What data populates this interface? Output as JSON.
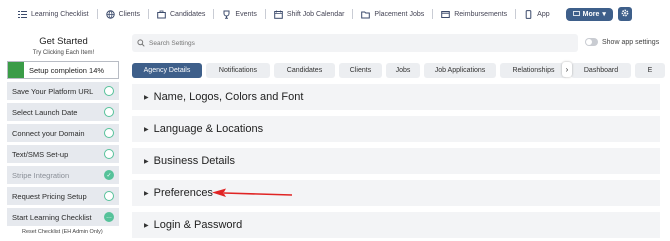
{
  "nav": {
    "items": [
      {
        "label": "Learning Checklist",
        "icon": "list-icon"
      },
      {
        "label": "Clients",
        "icon": "globe-icon"
      },
      {
        "label": "Candidates",
        "icon": "briefcase-icon"
      },
      {
        "label": "Events",
        "icon": "trophy-icon"
      },
      {
        "label": "Shift Job Calendar",
        "icon": "calendar-icon"
      },
      {
        "label": "Placement Jobs",
        "icon": "folder-icon"
      },
      {
        "label": "Reimbursements",
        "icon": "receipt-icon"
      },
      {
        "label": "App",
        "icon": "mobile-icon"
      }
    ],
    "more_label": "More",
    "accent": "#3e5f8a"
  },
  "sidebar": {
    "title": "Get Started",
    "subtitle": "Try Clicking Each Item!",
    "progress_label": "Setup completion 14%",
    "progress_percent": 14,
    "progress_color": "#3a9c47",
    "items": [
      {
        "label": "Save Your Platform URL",
        "status": "todo"
      },
      {
        "label": "Select Launch Date",
        "status": "todo"
      },
      {
        "label": "Connect your Domain",
        "status": "todo"
      },
      {
        "label": "Text/SMS Set-up",
        "status": "todo"
      },
      {
        "label": "Stripe Integration",
        "status": "done"
      },
      {
        "label": "Request Pricing Setup",
        "status": "todo"
      },
      {
        "label": "Start Learning Checklist",
        "status": "in-progress"
      }
    ],
    "reset_label": "Reset Checklist (EH Admin Only)"
  },
  "search": {
    "placeholder": "Search Settings",
    "toggle_label": "Show app settings",
    "toggle_on": false
  },
  "tabs": [
    {
      "label": "Agency Details",
      "active": true
    },
    {
      "label": "Notifications",
      "active": false
    },
    {
      "label": "Candidates",
      "active": false
    },
    {
      "label": "Clients",
      "active": false
    },
    {
      "label": "Jobs",
      "active": false
    },
    {
      "label": "Job Applications",
      "active": false
    },
    {
      "label": "Relationships",
      "active": false
    },
    {
      "label": "Dashboard",
      "active": false
    },
    {
      "label": "E",
      "active": false
    }
  ],
  "sections": [
    {
      "label": "Name, Logos, Colors and Font"
    },
    {
      "label": "Language & Locations"
    },
    {
      "label": "Business Details"
    },
    {
      "label": "Preferences",
      "highlighted": true
    },
    {
      "label": "Login & Password"
    }
  ],
  "annotation": {
    "icon": "red-arrow-icon",
    "color": "#e02424"
  }
}
